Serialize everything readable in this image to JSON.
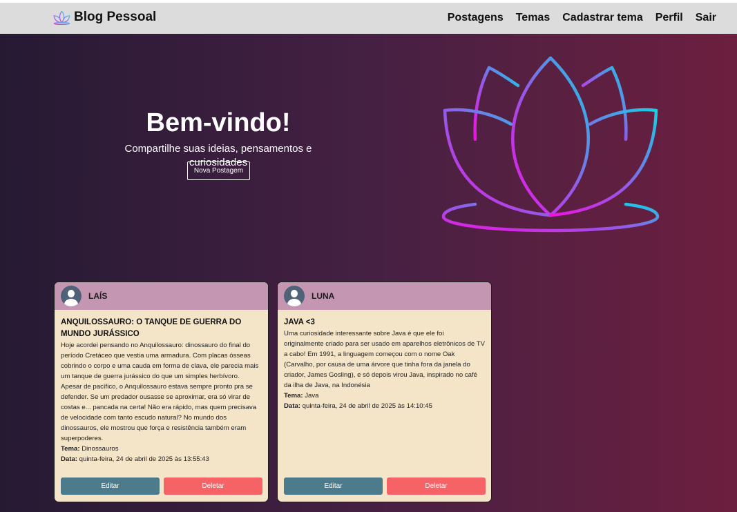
{
  "brand": {
    "name": "Blog Pessoal",
    "icon": "lotus-icon"
  },
  "nav": [
    "Postagens",
    "Temas",
    "Cadastrar tema",
    "Perfil",
    "Sair"
  ],
  "hero": {
    "title": "Bem-vindo!",
    "subtitle": "Compartilhe suas ideias, pensamentos e curiosidades",
    "button": "Nova Postagem"
  },
  "posts": [
    {
      "author": "LAÍS",
      "title": "ANQUILOSSAURO: O TANQUE DE GUERRA DO MUNDO JURÁSSICO",
      "text": "Hoje acordei pensando no Anquilossauro: dinossauro do final do período Cretáceo que vestia uma armadura. Com placas ósseas cobrindo o corpo e uma cauda em forma de clava, ele parecia mais um tanque de guerra jurássico do que um simples herbívoro. Apesar de pacífico, o Anquilossauro estava sempre pronto pra se defender. Se um predador ousasse se aproximar, era só virar de costas e... pancada na certa! Não era rápido, mas quem precisava de velocidade com tanto escudo natural? No mundo dos dinossauros, ele mostrou que força e resistência também eram superpoderes.",
      "theme_label": "Tema:",
      "theme": "Dinossauros",
      "date_label": "Data:",
      "date": "quinta-feira, 24 de abril de 2025 às 13:55:43",
      "edit": "Editar",
      "delete": "Deletar"
    },
    {
      "author": "LUNA",
      "title": "JAVA <3",
      "text": "Uma curiosidade interessante sobre Java é que ele foi originalmente criado para ser usado em aparelhos eletrônicos de TV a cabo! Em 1991, a linguagem começou com o nome Oak (Carvalho, por causa de uma árvore que tinha fora da janela do criador, James Gosling), e só depois virou Java, inspirado no café da ilha de Java, na Indonésia",
      "theme_label": "Tema:",
      "theme": "Java",
      "date_label": "Data:",
      "date": "quinta-feira, 24 de abril de 2025 às 14:10:45",
      "edit": "Editar",
      "delete": "Deletar"
    }
  ],
  "colors": {
    "navbar": "#dcdcdc",
    "card_header": "#c596b2",
    "card_body": "#f4e4c8",
    "edit_button": "#4c7b8c",
    "delete_button": "#f56366"
  }
}
